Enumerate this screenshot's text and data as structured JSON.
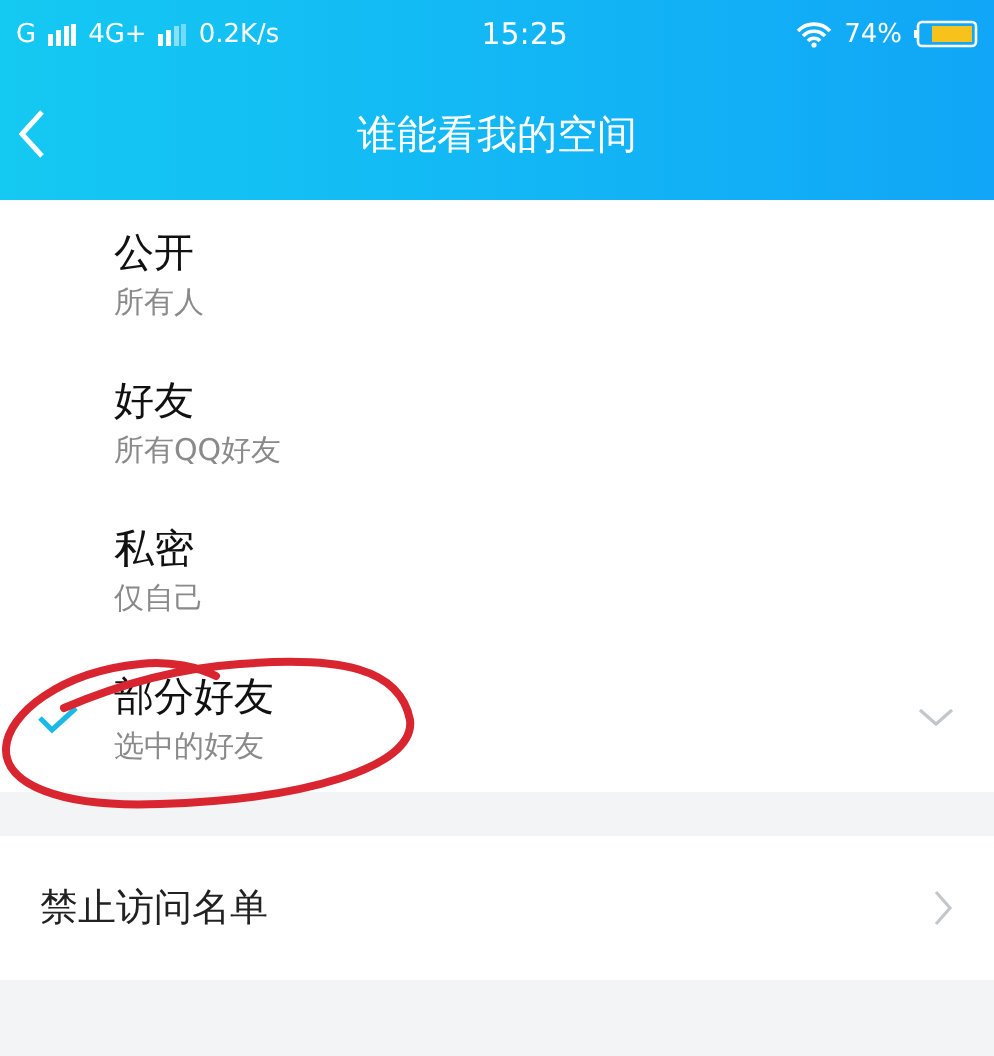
{
  "status_bar": {
    "carrier_1": "G",
    "carrier_2": "4G+",
    "speed": "0.2K/s",
    "time": "15:25",
    "battery": "74%"
  },
  "header": {
    "title": "谁能看我的空间"
  },
  "options": [
    {
      "title": "公开",
      "subtitle": "所有人",
      "selected": false,
      "expandable": false
    },
    {
      "title": "好友",
      "subtitle": "所有QQ好友",
      "selected": false,
      "expandable": false
    },
    {
      "title": "私密",
      "subtitle": "仅自己",
      "selected": false,
      "expandable": false
    },
    {
      "title": "部分好友",
      "subtitle": "选中的好友",
      "selected": true,
      "expandable": true
    }
  ],
  "links": [
    {
      "label": "禁止访问名单"
    }
  ],
  "annotation": {
    "kind": "circle"
  }
}
